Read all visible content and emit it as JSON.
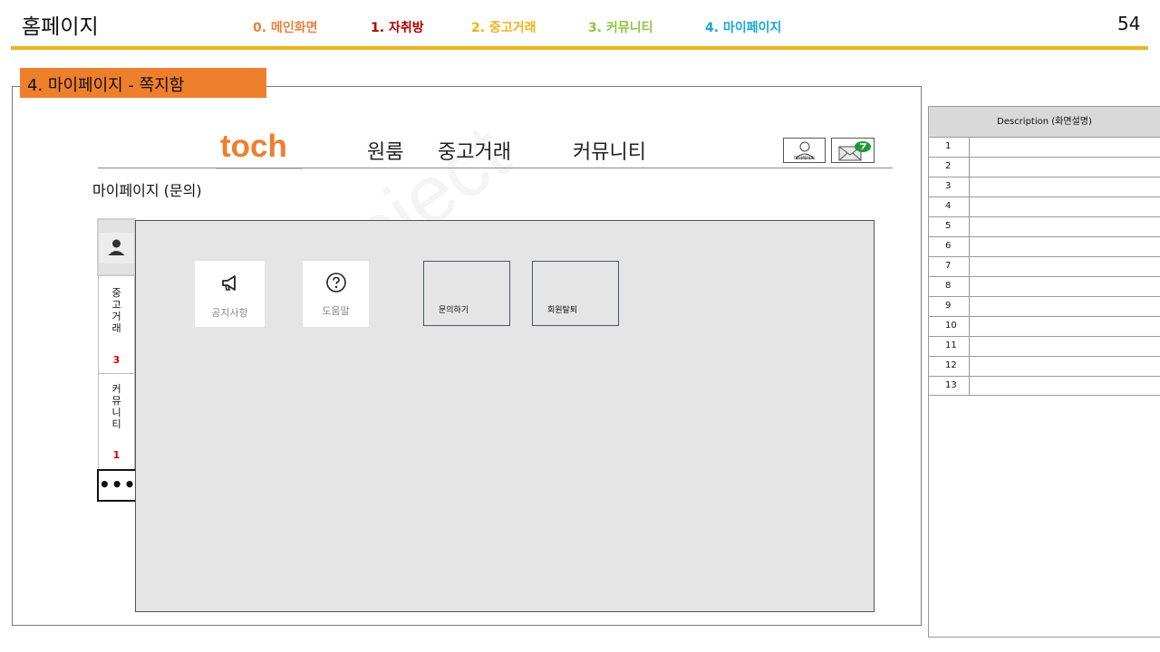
{
  "header": {
    "title": "홈페이지",
    "page_number": "54",
    "nav": [
      {
        "label": "0. 메인화면",
        "color": "#E8823A"
      },
      {
        "label": "1. 자취방",
        "color": "#B00000"
      },
      {
        "label": "2. 중고거래",
        "color": "#F0B21A"
      },
      {
        "label": "3. 커뮤니티",
        "color": "#8CC63E"
      },
      {
        "label": "4. 마이페이지",
        "color": "#1AA6D4"
      }
    ]
  },
  "section_label": "4. 마이페이지 - 쪽지함",
  "site": {
    "logo": "toch",
    "nav": [
      "원룸",
      "중고거래",
      "커뮤니티"
    ],
    "mypage_caption": "마이페이지",
    "message_icon": "envelope-with-new-badge-icon",
    "subtitle": "마이페이지 (문의)"
  },
  "sidebar": {
    "profile_icon": "person-icon",
    "groups": [
      {
        "label_chars": [
          "중",
          "고",
          "거",
          "래"
        ],
        "count": "3"
      },
      {
        "label_chars": [
          "커",
          "뮤",
          "니",
          "티"
        ],
        "count": "1"
      }
    ],
    "more": "•••"
  },
  "main": {
    "tiles": [
      {
        "label": "공지사항",
        "icon": "megaphone-icon"
      },
      {
        "label": "도움말",
        "icon": "question-circle-icon"
      }
    ],
    "buttons": [
      {
        "label": "문의하기"
      },
      {
        "label": "회원탈퇴"
      }
    ]
  },
  "watermark": "Toch Project",
  "description": {
    "header": "Description (화면설명)",
    "rows": [
      "1",
      "2",
      "3",
      "4",
      "5",
      "6",
      "7",
      "8",
      "9",
      "10",
      "11",
      "12",
      "13"
    ]
  }
}
